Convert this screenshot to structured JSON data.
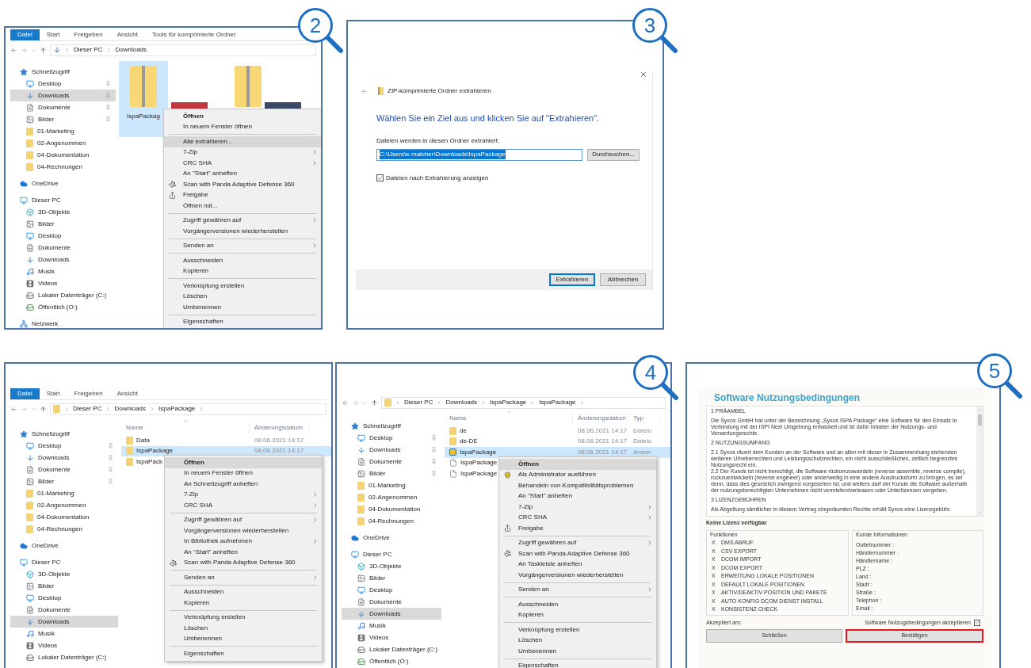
{
  "panels": [
    {
      "kind": "explorer",
      "badge": "2",
      "ribbon": [
        {
          "label": "Datei",
          "selected": true
        },
        {
          "label": "Start",
          "selected": false
        },
        {
          "label": "Freigeben",
          "selected": false
        },
        {
          "label": "Ansicht",
          "selected": false
        },
        {
          "label": "Tools für komprimierte Ordner",
          "selected": false
        }
      ],
      "path": [
        "Dieser PC",
        "Downloads"
      ],
      "trailing_chevron": false,
      "sidebar": [
        {
          "label": "Schnellzugriff",
          "kind": "star",
          "selected": false,
          "children": [
            {
              "label": "Desktop",
              "kind": "desktop",
              "selected": false,
              "pinned": true
            },
            {
              "label": "Downloads",
              "kind": "downloads",
              "selected": true,
              "pinned": true
            },
            {
              "label": "Dokumente",
              "kind": "documents",
              "selected": false,
              "pinned": true
            },
            {
              "label": "Bilder",
              "kind": "pictures",
              "selected": false,
              "pinned": true
            },
            {
              "label": "01-Marketing",
              "kind": "folder",
              "selected": false,
              "pinned": false
            },
            {
              "label": "02-Angenommen",
              "kind": "folder",
              "selected": false,
              "pinned": false
            },
            {
              "label": "04-Dokumentation",
              "kind": "folder",
              "selected": false,
              "pinned": false
            },
            {
              "label": "04-Rechnungen",
              "kind": "folder",
              "selected": false,
              "pinned": false
            }
          ]
        },
        {
          "label": "OneDrive",
          "kind": "cloud",
          "selected": false
        },
        {
          "label": "Dieser PC",
          "kind": "pc",
          "selected": false,
          "children": [
            {
              "label": "3D-Objekte",
              "kind": "objects",
              "selected": false
            },
            {
              "label": "Bilder",
              "kind": "pictures",
              "selected": false
            },
            {
              "label": "Desktop",
              "kind": "desktop",
              "selected": false
            },
            {
              "label": "Dokumente",
              "kind": "documents",
              "selected": false
            },
            {
              "label": "Downloads",
              "kind": "downloads",
              "selected": false
            },
            {
              "label": "Musik",
              "kind": "music",
              "selected": false
            },
            {
              "label": "Videos",
              "kind": "videos",
              "selected": false
            },
            {
              "label": "Lokaler Datenträger (C:)",
              "kind": "drive",
              "selected": false
            },
            {
              "label": "Öffentlich (O:)",
              "kind": "netdrive",
              "selected": false
            }
          ]
        },
        {
          "label": "Netzwerk",
          "kind": "network",
          "selected": false
        }
      ],
      "files": [
        {
          "kind": "zip",
          "label": "IspaPackag",
          "selected": true
        },
        {
          "kind": "photo",
          "selected": false
        },
        {
          "kind": "zip",
          "selected": false
        },
        {
          "kind": "photo",
          "selected": false
        }
      ],
      "menu": [
        [
          {
            "label": "Öffnen",
            "default": true,
            "selected": false,
            "submenu": false
          },
          {
            "label": "In neuem Fenster öffnen",
            "default": false,
            "selected": false,
            "submenu": false
          }
        ],
        [
          {
            "label": "Alle extrahieren...",
            "default": false,
            "selected": true,
            "submenu": false
          },
          {
            "label": "7-Zip",
            "default": false,
            "selected": false,
            "submenu": true
          },
          {
            "label": "CRC SHA",
            "default": false,
            "selected": false,
            "submenu": true
          },
          {
            "label": "An \"Start\" anheften",
            "default": false,
            "selected": false,
            "submenu": false
          },
          {
            "label": "Scan with Panda Adaptive Defense 360",
            "default": false,
            "selected": false,
            "submenu": false,
            "kind": "scanner"
          },
          {
            "label": "Freigabe",
            "default": false,
            "selected": false,
            "submenu": false,
            "kind": "share"
          },
          {
            "label": "Öffnen mit...",
            "default": false,
            "selected": false,
            "submenu": false
          }
        ],
        [
          {
            "label": "Zugriff gewähren auf",
            "default": false,
            "selected": false,
            "submenu": true
          },
          {
            "label": "Vorgängerversionen wiederherstellen",
            "default": false,
            "selected": false,
            "submenu": false
          }
        ],
        [
          {
            "label": "Senden an",
            "default": false,
            "selected": false,
            "submenu": true
          }
        ],
        [
          {
            "label": "Ausschneiden",
            "default": false,
            "selected": false,
            "submenu": false
          },
          {
            "label": "Kopieren",
            "default": false,
            "selected": false,
            "submenu": false
          }
        ],
        [
          {
            "label": "Verknüpfung erstellen",
            "default": false,
            "selected": false,
            "submenu": false
          },
          {
            "label": "Löschen",
            "default": false,
            "selected": false,
            "submenu": false
          },
          {
            "label": "Umbenennen",
            "default": false,
            "selected": false,
            "submenu": false
          }
        ],
        [
          {
            "label": "Eigenschaften",
            "default": false,
            "selected": false,
            "submenu": false
          }
        ]
      ]
    },
    {
      "kind": "extract_dialog",
      "badge": "3",
      "title": "ZIP-komprimierte Ordner extrahieren",
      "heading": "Wählen Sie ein Ziel aus und klicken Sie auf \"Extrahieren\".",
      "field_label": "Dateien werden in diesen Ordner extrahiert:",
      "path": "C:\\Users\\e.maicher\\Downloads\\IspaPackage",
      "browse": "Durchsuchen...",
      "checkbox": {
        "label": "Dateien nach Extrahierung anzeigen",
        "checked": true
      },
      "buttons": [
        {
          "label": "Extrahieren",
          "primary": true
        },
        {
          "label": "Abbrechen",
          "primary": false
        }
      ]
    },
    {
      "kind": "explorer",
      "ribbon": [
        {
          "label": "Datei",
          "selected": true
        },
        {
          "label": "Start",
          "selected": false
        },
        {
          "label": "Freigeben",
          "selected": false
        },
        {
          "label": "Ansicht",
          "selected": false
        }
      ],
      "path": [
        "Dieser PC",
        "Downloads",
        "IspaPackage"
      ],
      "trailing_chevron": true,
      "sidebar": [
        {
          "label": "Schnellzugriff",
          "kind": "star",
          "selected": false,
          "children": [
            {
              "label": "Desktop",
              "kind": "desktop",
              "selected": false,
              "pinned": true
            },
            {
              "label": "Downloads",
              "kind": "downloads",
              "selected": false,
              "pinned": true
            },
            {
              "label": "Dokumente",
              "kind": "documents",
              "selected": false,
              "pinned": true
            },
            {
              "label": "Bilder",
              "kind": "pictures",
              "selected": false,
              "pinned": true
            },
            {
              "label": "01-Marketing",
              "kind": "folder",
              "selected": false,
              "pinned": false
            },
            {
              "label": "02-Angenommen",
              "kind": "folder",
              "selected": false,
              "pinned": false
            },
            {
              "label": "04-Dokumentation",
              "kind": "folder",
              "selected": false,
              "pinned": false
            },
            {
              "label": "04-Rechnungen",
              "kind": "folder",
              "selected": false,
              "pinned": false
            }
          ]
        },
        {
          "label": "OneDrive",
          "kind": "cloud",
          "selected": false
        },
        {
          "label": "Dieser PC",
          "kind": "pc",
          "selected": false,
          "children": [
            {
              "label": "3D-Objekte",
              "kind": "objects",
              "selected": false
            },
            {
              "label": "Bilder",
              "kind": "pictures",
              "selected": false
            },
            {
              "label": "Desktop",
              "kind": "desktop",
              "selected": false
            },
            {
              "label": "Dokumente",
              "kind": "documents",
              "selected": false
            },
            {
              "label": "Downloads",
              "kind": "downloads",
              "selected": true
            },
            {
              "label": "Musik",
              "kind": "music",
              "selected": false
            },
            {
              "label": "Videos",
              "kind": "videos",
              "selected": false
            },
            {
              "label": "Lokaler Datenträger (C:)",
              "kind": "drive",
              "selected": false
            }
          ]
        }
      ],
      "columns": [
        "Name",
        "Änderungsdatum"
      ],
      "rows": [
        {
          "kind": "folder",
          "cells": [
            "Data",
            "08.06.2021 14:17"
          ],
          "selected": false
        },
        {
          "kind": "folder",
          "cells": [
            "IspaPackage",
            "08.06.2021 14:17"
          ],
          "selected": true
        },
        {
          "kind": "folder",
          "cells": [
            "IspaPack"
          ],
          "selected": false
        }
      ],
      "menu": [
        [
          {
            "label": "Öffnen",
            "default": true,
            "selected": true,
            "submenu": false
          },
          {
            "label": "In neuem Fenster öffnen",
            "default": false,
            "selected": false,
            "submenu": false
          },
          {
            "label": "An Schnellzugriff anheften",
            "default": false,
            "selected": false,
            "submenu": false
          },
          {
            "label": "7-Zip",
            "default": false,
            "selected": false,
            "submenu": true
          },
          {
            "label": "CRC SHA",
            "default": false,
            "selected": false,
            "submenu": true
          }
        ],
        [
          {
            "label": "Zugriff gewähren auf",
            "default": false,
            "selected": false,
            "submenu": true
          },
          {
            "label": "Vorgängerversionen wiederherstellen",
            "default": false,
            "selected": false,
            "submenu": false
          },
          {
            "label": "In Bibliothek aufnehmen",
            "default": false,
            "selected": false,
            "submenu": true
          },
          {
            "label": "An \"Start\" anheften",
            "default": false,
            "selected": false,
            "submenu": false
          },
          {
            "label": "Scan with Panda Adaptive Defense 360",
            "default": false,
            "selected": false,
            "submenu": false,
            "kind": "scanner"
          }
        ],
        [
          {
            "label": "Senden an",
            "default": false,
            "selected": false,
            "submenu": true
          }
        ],
        [
          {
            "label": "Ausschneiden",
            "default": false,
            "selected": false,
            "submenu": false
          },
          {
            "label": "Kopieren",
            "default": false,
            "selected": false,
            "submenu": false
          }
        ],
        [
          {
            "label": "Verknüpfung erstellen",
            "default": false,
            "selected": false,
            "submenu": false
          },
          {
            "label": "Löschen",
            "default": false,
            "selected": false,
            "submenu": false
          },
          {
            "label": "Umbenennen",
            "default": false,
            "selected": false,
            "submenu": false
          }
        ],
        [
          {
            "label": "Eigenschaften",
            "default": false,
            "selected": false,
            "submenu": false
          }
        ]
      ]
    },
    {
      "kind": "explorer",
      "badge": "4",
      "path": [
        "Dieser PC",
        "Downloads",
        "IspaPackage",
        "IspaPackage"
      ],
      "trailing_chevron": true,
      "sidebar": [
        {
          "label": "Schnellzugriff",
          "kind": "star",
          "selected": false,
          "children": [
            {
              "label": "Desktop",
              "kind": "desktop",
              "selected": false,
              "pinned": true
            },
            {
              "label": "Downloads",
              "kind": "downloads",
              "selected": false,
              "pinned": true
            },
            {
              "label": "Dokumente",
              "kind": "documents",
              "selected": false,
              "pinned": true
            },
            {
              "label": "Bilder",
              "kind": "pictures",
              "selected": false,
              "pinned": true
            },
            {
              "label": "01-Marketing",
              "kind": "folder",
              "selected": false,
              "pinned": false
            },
            {
              "label": "02-Angenommen",
              "kind": "folder",
              "selected": false,
              "pinned": false
            },
            {
              "label": "04-Dokumentation",
              "kind": "folder",
              "selected": false,
              "pinned": false
            },
            {
              "label": "04-Rechnungen",
              "kind": "folder",
              "selected": false,
              "pinned": false
            }
          ]
        },
        {
          "label": "OneDrive",
          "kind": "cloud",
          "selected": false
        },
        {
          "label": "Dieser PC",
          "kind": "pc",
          "selected": false,
          "children": [
            {
              "label": "3D-Objekte",
              "kind": "objects",
              "selected": false
            },
            {
              "label": "Bilder",
              "kind": "pictures",
              "selected": false
            },
            {
              "label": "Desktop",
              "kind": "desktop",
              "selected": false
            },
            {
              "label": "Dokumente",
              "kind": "documents",
              "selected": false
            },
            {
              "label": "Downloads",
              "kind": "downloads",
              "selected": true
            },
            {
              "label": "Musik",
              "kind": "music",
              "selected": false
            },
            {
              "label": "Videos",
              "kind": "videos",
              "selected": false
            },
            {
              "label": "Lokaler Datenträger (C:)",
              "kind": "drive",
              "selected": false
            },
            {
              "label": "Öffentlich (O:)",
              "kind": "netdrive",
              "selected": false
            }
          ]
        }
      ],
      "columns": [
        "Name",
        "Änderungsdatum",
        "Typ"
      ],
      "rows": [
        {
          "kind": "folder",
          "cells": [
            "de",
            "08.06.2021 14:17",
            "Dateio"
          ],
          "selected": false
        },
        {
          "kind": "folder",
          "cells": [
            "de-DE",
            "08.06.2021 14:17",
            "Dateio"
          ],
          "selected": false
        },
        {
          "kind": "app",
          "cells": [
            "IspaPackage",
            "08.06.2021 14:17",
            "Anwer"
          ],
          "selected": true
        },
        {
          "kind": "file",
          "cells": [
            "IspaPackage"
          ],
          "selected": false
        },
        {
          "kind": "file",
          "cells": [
            "IspaPackage"
          ],
          "selected": false
        }
      ],
      "menu": [
        [
          {
            "label": "Öffnen",
            "default": true,
            "selected": true,
            "submenu": false
          },
          {
            "label": "Als Administrator ausführen",
            "default": false,
            "selected": false,
            "submenu": false,
            "kind": "shield"
          },
          {
            "label": "Behandeln von Kompatibilitätsproblemen",
            "default": false,
            "selected": false,
            "submenu": false
          },
          {
            "label": "An \"Start\" anheften",
            "default": false,
            "selected": false,
            "submenu": false
          },
          {
            "label": "7-Zip",
            "default": false,
            "selected": false,
            "submenu": true
          },
          {
            "label": "CRC SHA",
            "default": false,
            "selected": false,
            "submenu": true
          },
          {
            "label": "Freigabe",
            "default": false,
            "selected": false,
            "submenu": false,
            "kind": "share"
          }
        ],
        [
          {
            "label": "Zugriff gewähren auf",
            "default": false,
            "selected": false,
            "submenu": true
          },
          {
            "label": "Scan with Panda Adaptive Defense 360",
            "default": false,
            "selected": false,
            "submenu": false,
            "kind": "scanner"
          },
          {
            "label": "An Taskleiste anheften",
            "default": false,
            "selected": false,
            "submenu": false
          },
          {
            "label": "Vorgängerversionen wiederherstellen",
            "default": false,
            "selected": false,
            "submenu": false
          }
        ],
        [
          {
            "label": "Senden an",
            "default": false,
            "selected": false,
            "submenu": true
          }
        ],
        [
          {
            "label": "Ausschneiden",
            "default": false,
            "selected": false,
            "submenu": false
          },
          {
            "label": "Kopieren",
            "default": false,
            "selected": false,
            "submenu": false
          }
        ],
        [
          {
            "label": "Verknüpfung erstellen",
            "default": false,
            "selected": false,
            "submenu": false
          },
          {
            "label": "Löschen",
            "default": false,
            "selected": false,
            "submenu": false
          },
          {
            "label": "Umbenennen",
            "default": false,
            "selected": false,
            "submenu": false
          }
        ],
        [
          {
            "label": "Eigenschaften",
            "default": false,
            "selected": false,
            "submenu": false
          }
        ]
      ]
    },
    {
      "kind": "license_dialog",
      "badge": "5",
      "title": "Software Nutzungsbedingungen",
      "terms": [
        [
          "1 PRÄAMBEL"
        ],
        [
          "Die Syxos GmbH hat unter der Bezeichnung „Syxos ISPA Package“ eine Software für den Einsatz in Verbindung mit der ISPI Next Umgebung entwickelt und ist dafür Inhaber der Nutzungs- und Verwertungsrechte."
        ],
        [
          "2 NUTZUNGSUMFANG"
        ],
        [
          "2.1 Syxos räumt dem Kunden an der Software und an allen mit dieser in Zusammenhang stehenden weiteren Urheberrechten und Leistungsschutzrechten, ein nicht ausschließliches, zeitlich begrenztes Nutzungsrecht ein.",
          "2.2 Der Kunde ist nicht berechtigt, die Software rückumzuwandeln (reverse assemble, reverse compile), rückzuentwickeln (reverse engineer) oder anderweitig in eine andere Ausdrucksform zu bringen, es sei denn, dass dies gesetzlich zwingend vorgesehen ist; und weiters darf der Kunde die Software außerhalb der nutzungsberechtigten Unternehmen nicht vermieten/verleasen oder Unterlizenzen vergeben."
        ],
        [
          "3 LIZENZGEBÜHREN"
        ],
        [
          "Als Abgeltung sämtlicher in diesem Vertrag eingeräumten Rechte erhält Syxos eine Lizenzgebühr."
        ]
      ],
      "license_status": "Keine Lizenz verfügbar",
      "functions": {
        "title": "Funktionen",
        "items": [
          {
            "mark": "X",
            "label": "DMS ABRUF"
          },
          {
            "mark": "X",
            "label": "CSV EXPORT"
          },
          {
            "mark": "X",
            "label": "DCOM IMPORT"
          },
          {
            "mark": "X",
            "label": "DCOM EXPORT"
          },
          {
            "mark": "X",
            "label": "ERWEITUNG LOKALE POSITIONEN"
          },
          {
            "mark": "X",
            "label": "DEFAULT LOKALE POSITIONEN"
          },
          {
            "mark": "X",
            "label": "AKTIV/DEAKTIV POSITION UND PAKETE"
          },
          {
            "mark": "X",
            "label": "AUTO KONFIG DCOM DIENST INSTALL"
          },
          {
            "mark": "X",
            "label": "KONSISTENZ CHECK"
          }
        ]
      },
      "customer": {
        "title": "Kunde Informationen",
        "fields": [
          "Outletnummer :",
          "Händlernummer :",
          "Händlername :",
          "PLZ :",
          "Land :",
          "Stadt :",
          "Straße :",
          "Telephon :",
          "Email :"
        ]
      },
      "accepted_label": "Akzeptiert am:",
      "accept": {
        "label": "Software Nutzugsbedingungen akzeptieren",
        "checked": true
      },
      "buttons": [
        {
          "label": "Schließen",
          "highlighted": false
        },
        {
          "label": "Bestätigen",
          "highlighted": true
        }
      ]
    }
  ]
}
